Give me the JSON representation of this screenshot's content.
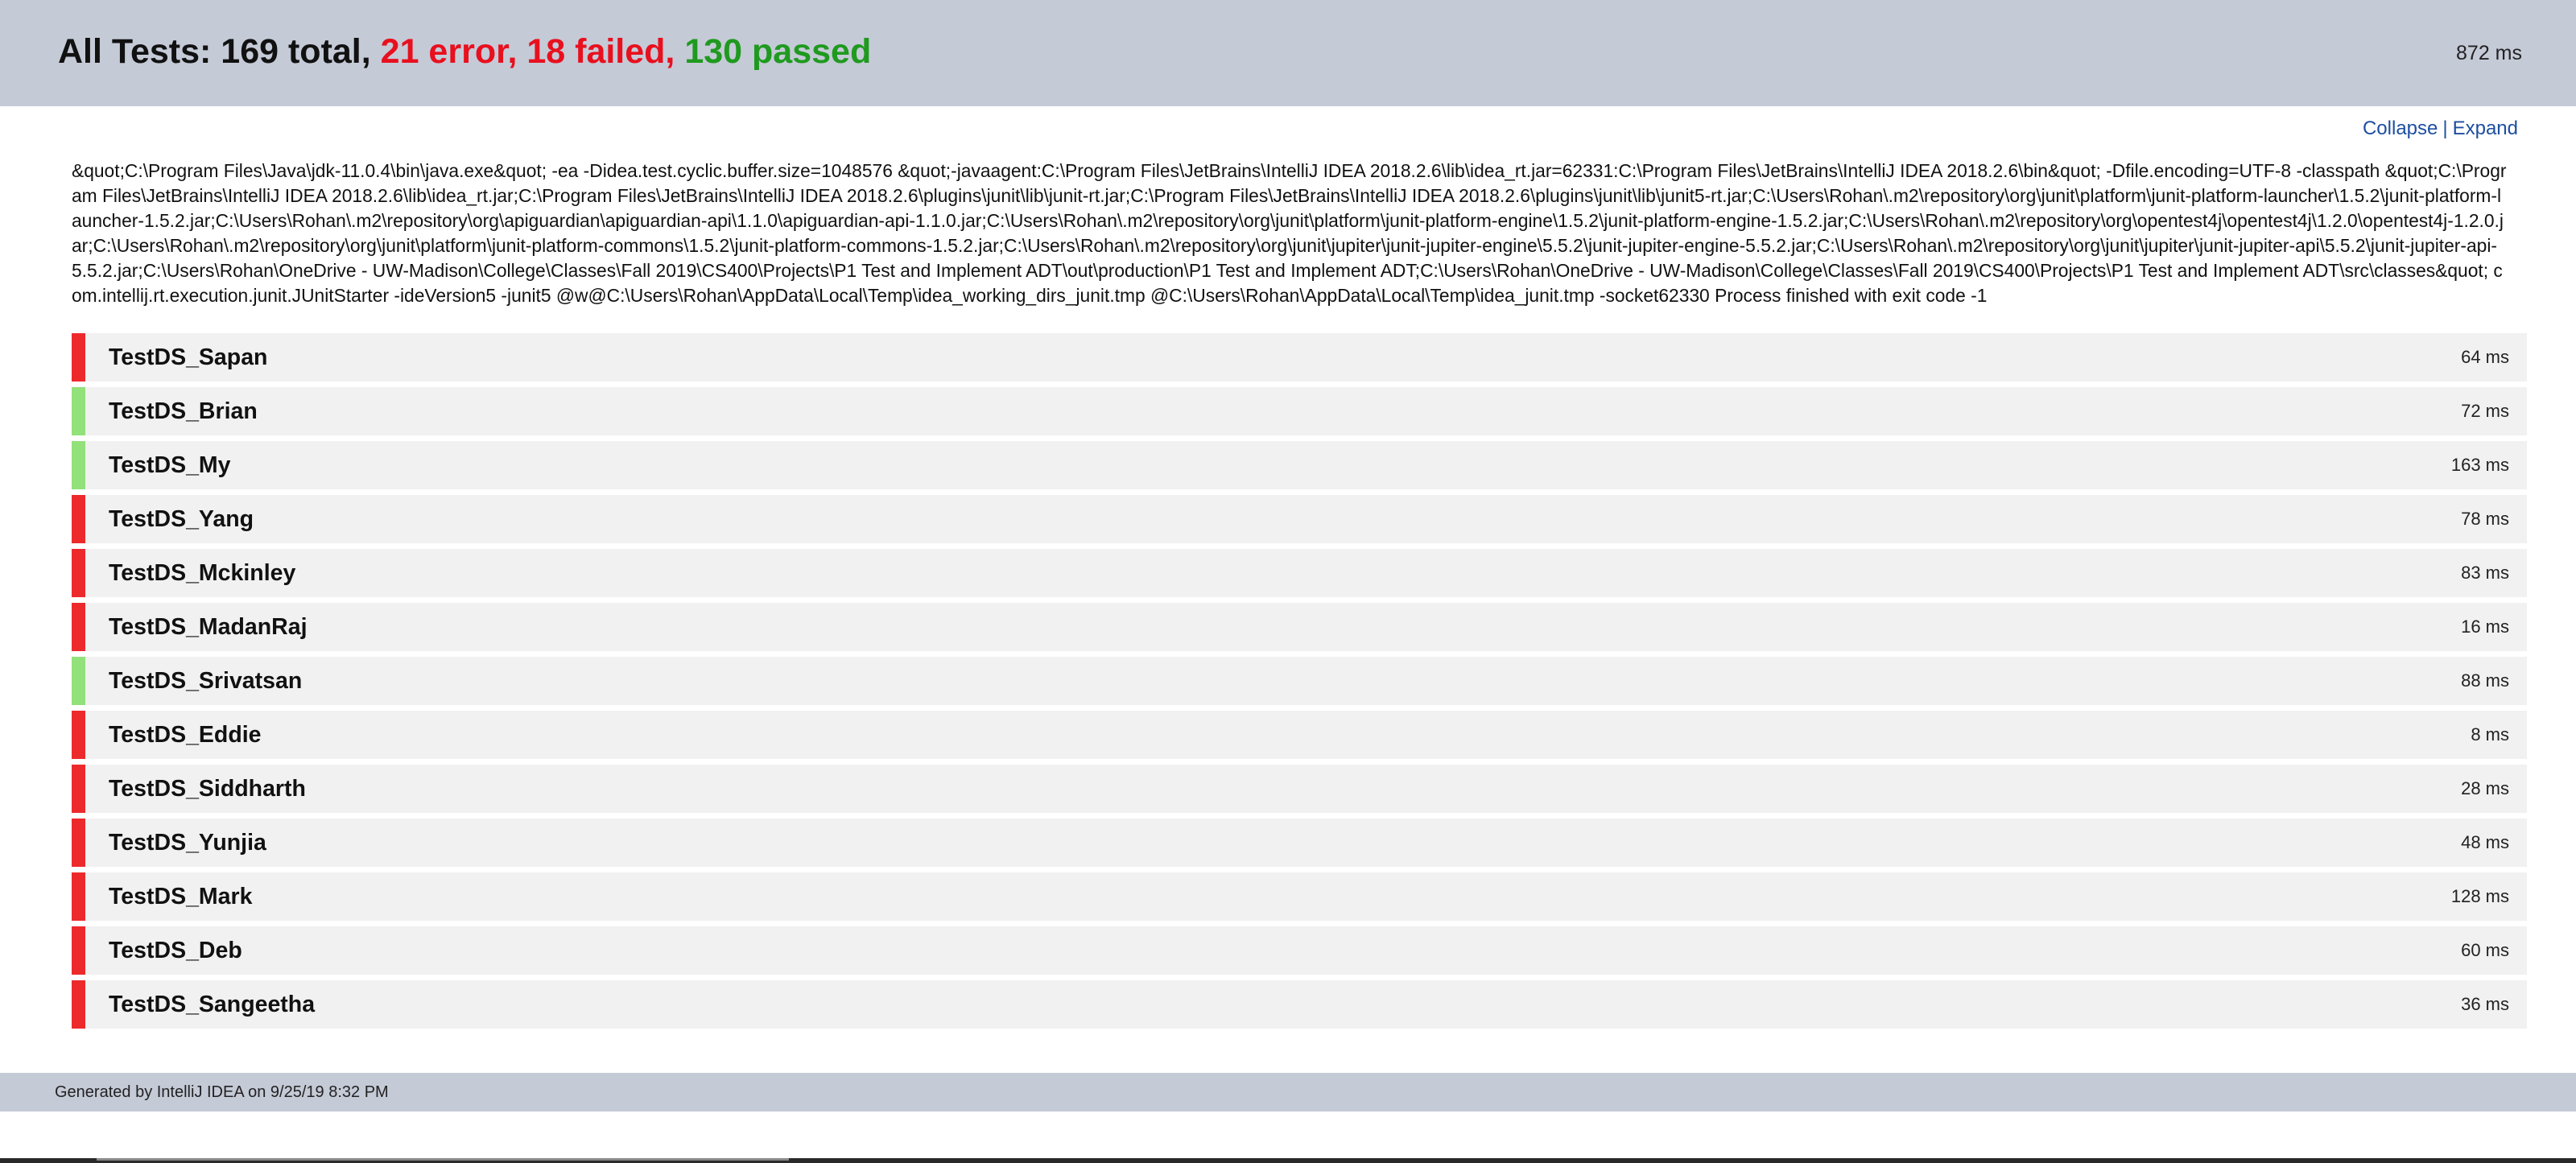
{
  "header": {
    "prefix": "All Tests: 169 total, ",
    "error": "21 error, ",
    "failed": "18 failed, ",
    "passed": "130 passed",
    "duration": "872 ms"
  },
  "toggle": {
    "collapse": "Collapse",
    "separator": "|",
    "expand": "Expand"
  },
  "command_output": "&quot;C:\\Program Files\\Java\\jdk-11.0.4\\bin\\java.exe&quot; -ea -Didea.test.cyclic.buffer.size=1048576 &quot;-javaagent:C:\\Program Files\\JetBrains\\IntelliJ IDEA 2018.2.6\\lib\\idea_rt.jar=62331:C:\\Program Files\\JetBrains\\IntelliJ IDEA 2018.2.6\\bin&quot; -Dfile.encoding=UTF-8 -classpath &quot;C:\\Program Files\\JetBrains\\IntelliJ IDEA 2018.2.6\\lib\\idea_rt.jar;C:\\Program Files\\JetBrains\\IntelliJ IDEA 2018.2.6\\plugins\\junit\\lib\\junit-rt.jar;C:\\Program Files\\JetBrains\\IntelliJ IDEA 2018.2.6\\plugins\\junit\\lib\\junit5-rt.jar;C:\\Users\\Rohan\\.m2\\repository\\org\\junit\\platform\\junit-platform-launcher\\1.5.2\\junit-platform-launcher-1.5.2.jar;C:\\Users\\Rohan\\.m2\\repository\\org\\apiguardian\\apiguardian-api\\1.1.0\\apiguardian-api-1.1.0.jar;C:\\Users\\Rohan\\.m2\\repository\\org\\junit\\platform\\junit-platform-engine\\1.5.2\\junit-platform-engine-1.5.2.jar;C:\\Users\\Rohan\\.m2\\repository\\org\\opentest4j\\opentest4j\\1.2.0\\opentest4j-1.2.0.jar;C:\\Users\\Rohan\\.m2\\repository\\org\\junit\\platform\\junit-platform-commons\\1.5.2\\junit-platform-commons-1.5.2.jar;C:\\Users\\Rohan\\.m2\\repository\\org\\junit\\jupiter\\junit-jupiter-engine\\5.5.2\\junit-jupiter-engine-5.5.2.jar;C:\\Users\\Rohan\\.m2\\repository\\org\\junit\\jupiter\\junit-jupiter-api\\5.5.2\\junit-jupiter-api-5.5.2.jar;C:\\Users\\Rohan\\OneDrive - UW-Madison\\College\\Classes\\Fall 2019\\CS400\\Projects\\P1 Test and Implement ADT\\out\\production\\P1 Test and Implement ADT;C:\\Users\\Rohan\\OneDrive - UW-Madison\\College\\Classes\\Fall 2019\\CS400\\Projects\\P1 Test and Implement ADT\\src\\classes&quot; com.intellij.rt.execution.junit.JUnitStarter -ideVersion5 -junit5 @w@C:\\Users\\Rohan\\AppData\\Local\\Temp\\idea_working_dirs_junit.tmp @C:\\Users\\Rohan\\AppData\\Local\\Temp\\idea_junit.tmp -socket62330 Process finished with exit code -1",
  "tests": [
    {
      "name": "TestDS_Sapan",
      "time": "64 ms",
      "status": "failed"
    },
    {
      "name": "TestDS_Brian",
      "time": "72 ms",
      "status": "passed"
    },
    {
      "name": "TestDS_My",
      "time": "163 ms",
      "status": "passed"
    },
    {
      "name": "TestDS_Yang",
      "time": "78 ms",
      "status": "failed"
    },
    {
      "name": "TestDS_Mckinley",
      "time": "83 ms",
      "status": "failed"
    },
    {
      "name": "TestDS_MadanRaj",
      "time": "16 ms",
      "status": "failed"
    },
    {
      "name": "TestDS_Srivatsan",
      "time": "88 ms",
      "status": "passed"
    },
    {
      "name": "TestDS_Eddie",
      "time": "8 ms",
      "status": "failed"
    },
    {
      "name": "TestDS_Siddharth",
      "time": "28 ms",
      "status": "failed"
    },
    {
      "name": "TestDS_Yunjia",
      "time": "48 ms",
      "status": "failed"
    },
    {
      "name": "TestDS_Mark",
      "time": "128 ms",
      "status": "failed"
    },
    {
      "name": "TestDS_Deb",
      "time": "60 ms",
      "status": "failed"
    },
    {
      "name": "TestDS_Sangeetha",
      "time": "36 ms",
      "status": "failed"
    }
  ],
  "footer": {
    "text": "Generated by IntelliJ IDEA on 9/25/19 8:32 PM"
  },
  "colors": {
    "header_bg": "#c5cad7",
    "error": "#e8101e",
    "passed_text": "#1f9a1f",
    "status_failed": "#ec2a2c",
    "status_passed": "#93e17a",
    "link": "#1d4fa0"
  }
}
